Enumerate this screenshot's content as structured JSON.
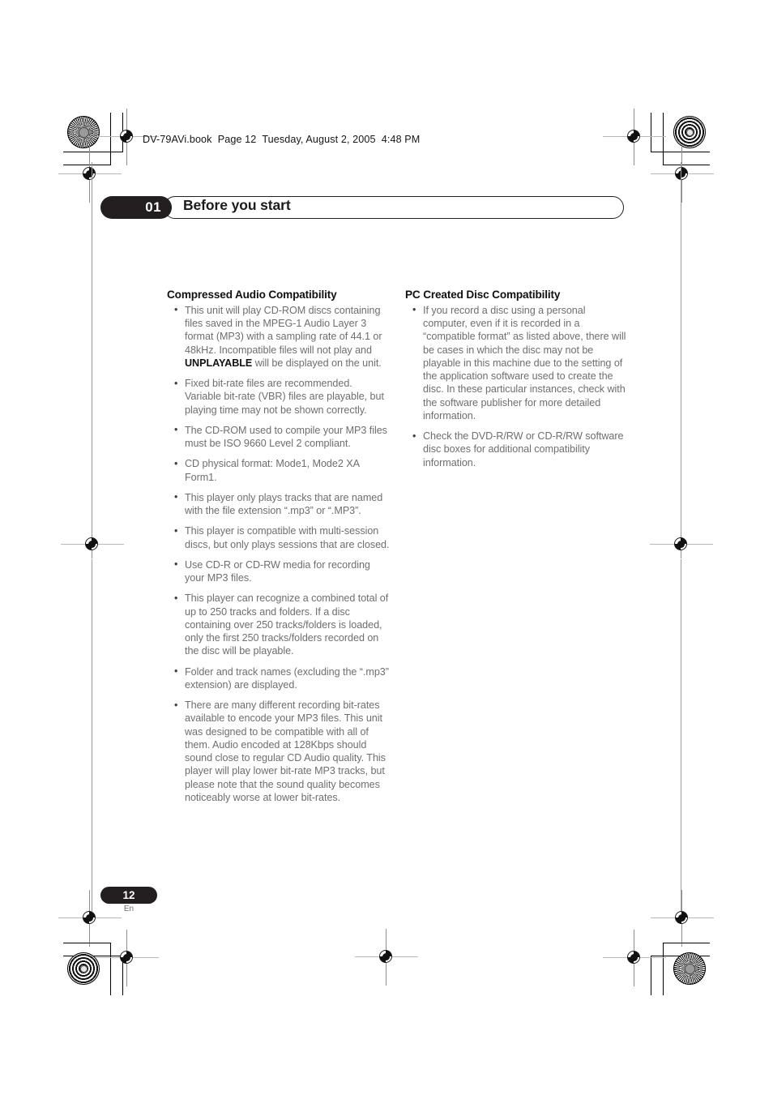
{
  "header": {
    "slug": "DV-79AVi.book  Page 12  Tuesday, August 2, 2005  4:48 PM"
  },
  "chapter": {
    "number": "01",
    "title": "Before you start"
  },
  "colors": {
    "ink_black": "#231f20",
    "body_gray": "#6e6e6e",
    "heading_black": "#111111"
  },
  "sections": [
    {
      "heading": "Compressed Audio Compatibility",
      "bullets": [
        {
          "parts": [
            {
              "text": "This unit will play CD-ROM discs containing files saved in the MPEG-1 Audio Layer 3 format (MP3) with a sampling rate of 44.1 or 48kHz. Incompatible files will not play and ",
              "bold": false
            },
            {
              "text": "UNPLAYABLE",
              "bold": true
            },
            {
              "text": " will be displayed on the unit.",
              "bold": false
            }
          ]
        },
        {
          "parts": [
            {
              "text": "Fixed bit-rate files are recommended. Variable bit-rate (VBR) files are playable, but playing time may not be shown correctly.",
              "bold": false
            }
          ]
        },
        {
          "parts": [
            {
              "text": "The CD-ROM used to compile your MP3 files must be ISO 9660 Level 2 compliant.",
              "bold": false
            }
          ]
        },
        {
          "parts": [
            {
              "text": "CD physical format: Mode1, Mode2 XA Form1.",
              "bold": false
            }
          ]
        },
        {
          "parts": [
            {
              "text": "This player only plays tracks that are named with the file extension “.mp3” or “.MP3”.",
              "bold": false
            }
          ]
        },
        {
          "parts": [
            {
              "text": "This player is compatible with multi-session discs, but only plays sessions that are closed.",
              "bold": false
            }
          ]
        },
        {
          "parts": [
            {
              "text": "Use CD-R or CD-RW media for recording your MP3 files.",
              "bold": false
            }
          ]
        },
        {
          "parts": [
            {
              "text": "This player can recognize a combined total of up to 250 tracks and folders. If a disc containing over 250 tracks/folders is loaded, only the first 250 tracks/folders recorded on the disc will be playable.",
              "bold": false
            }
          ]
        },
        {
          "parts": [
            {
              "text": "Folder and track names (excluding the “.mp3” extension) are displayed.",
              "bold": false
            }
          ]
        },
        {
          "parts": [
            {
              "text": "There are many different recording bit-rates available to encode your MP3 files. This unit was designed to be compatible with all of them. Audio encoded at 128Kbps should sound close to regular CD Audio quality. This player will play lower bit-rate MP3 tracks, but please note that the sound quality becomes noticeably worse at lower bit-rates.",
              "bold": false
            }
          ]
        }
      ]
    },
    {
      "heading": "PC Created Disc Compatibility",
      "bullets": [
        {
          "parts": [
            {
              "text": "If you record a disc using a personal computer, even if it is recorded in a “compatible format” as listed above, there will be cases in which the disc may not be playable in this machine due to the setting of the application software used to create the disc. In these particular instances, check with the software publisher for more detailed information.",
              "bold": false
            }
          ]
        },
        {
          "parts": [
            {
              "text": "Check the DVD-R/RW or CD-R/RW software disc boxes for additional compatibility information.",
              "bold": false
            }
          ]
        }
      ]
    }
  ],
  "footer": {
    "page_number": "12",
    "language": "En"
  }
}
